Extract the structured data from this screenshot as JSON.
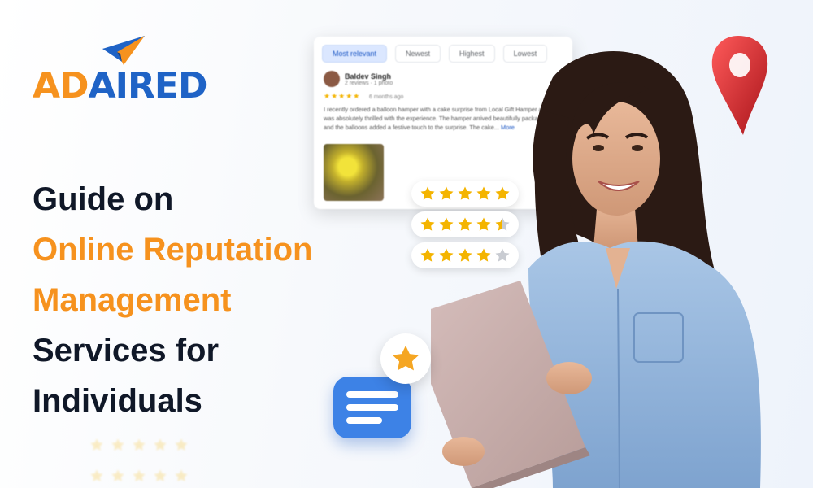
{
  "brand": {
    "logo_text_left": "AD",
    "logo_text_right": "AIRED",
    "color_orange": "#f6921e",
    "color_blue": "#1f63c6"
  },
  "headline": {
    "line1": "Guide on",
    "line2": "Online Reputation",
    "line3": "Management",
    "line4": "Services for",
    "line5": "Individuals"
  },
  "review_card": {
    "chips": [
      "Most relevant",
      "Newest",
      "Highest",
      "Lowest"
    ],
    "reviewer_name": "Baldev Singh",
    "reviewer_meta": "2 reviews · 1 photo",
    "time": "6 months ago",
    "text": "I recently ordered a balloon hamper with a cake surprise from Local Gift Hamper and I was absolutely thrilled with the experience. The hamper arrived beautifully packaged, and the balloons added a festive touch to the surprise. The cake...",
    "more_label": "More"
  },
  "ratings": [
    5,
    4.5,
    4
  ],
  "colors": {
    "star": "#f4b400",
    "star_empty": "#c9ccd2",
    "pin": "#d8262c",
    "chat": "#3d82e6"
  },
  "icons": [
    "paper-plane-icon",
    "location-pin-icon",
    "chat-bubble-icon",
    "star-icon",
    "kebab-icon"
  ]
}
